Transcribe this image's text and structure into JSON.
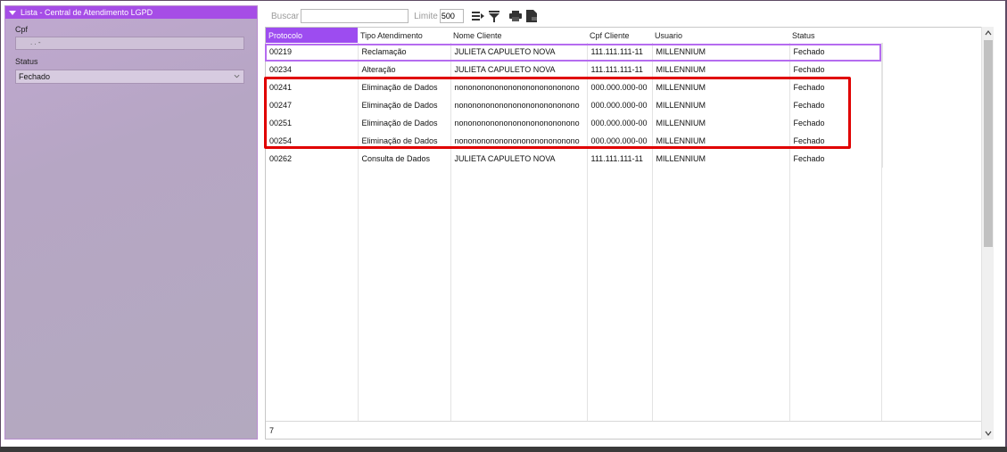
{
  "panel": {
    "title": "Lista - Central de Atendimento LGPD",
    "cpf_label": "Cpf",
    "cpf_value": ". . -",
    "status_label": "Status",
    "status_value": "Fechado"
  },
  "toolbar": {
    "search_label": "Buscar",
    "search_value": "",
    "limit_label": "Limite",
    "limit_value": "500",
    "icons": [
      "sort-icon",
      "filter-icon",
      "print-icon",
      "export-icon"
    ]
  },
  "grid": {
    "columns": [
      "Protocolo",
      "Tipo Atendimento",
      "Nome Cliente",
      "Cpf Cliente",
      "Usuario",
      "Status"
    ],
    "rows": [
      [
        "00219",
        "Reclamação",
        "JULIETA CAPULETO NOVA",
        "111.111.111-11",
        "MILLENNIUM",
        "Fechado"
      ],
      [
        "00234",
        "Alteração",
        "JULIETA CAPULETO NOVA",
        "111.111.111-11",
        "MILLENNIUM",
        "Fechado"
      ],
      [
        "00241",
        "Eliminação de Dados",
        "nononononononononononononono",
        "000.000.000-00",
        "MILLENNIUM",
        "Fechado"
      ],
      [
        "00247",
        "Eliminação de Dados",
        "nononononononononononononono",
        "000.000.000-00",
        "MILLENNIUM",
        "Fechado"
      ],
      [
        "00251",
        "Eliminação de Dados",
        "nononononononononononononono",
        "000.000.000-00",
        "MILLENNIUM",
        "Fechado"
      ],
      [
        "00254",
        "Eliminação de Dados",
        "nononononononononononononono",
        "000.000.000-00",
        "MILLENNIUM",
        "Fechado"
      ],
      [
        "00262",
        "Consulta de Dados",
        "JULIETA CAPULETO NOVA",
        "111.111.111-11",
        "MILLENNIUM",
        "Fechado"
      ]
    ],
    "record_count": "7"
  },
  "colors": {
    "accent": "#9d4cf0",
    "panel_header": "#a64de6",
    "highlight": "#e00000"
  }
}
